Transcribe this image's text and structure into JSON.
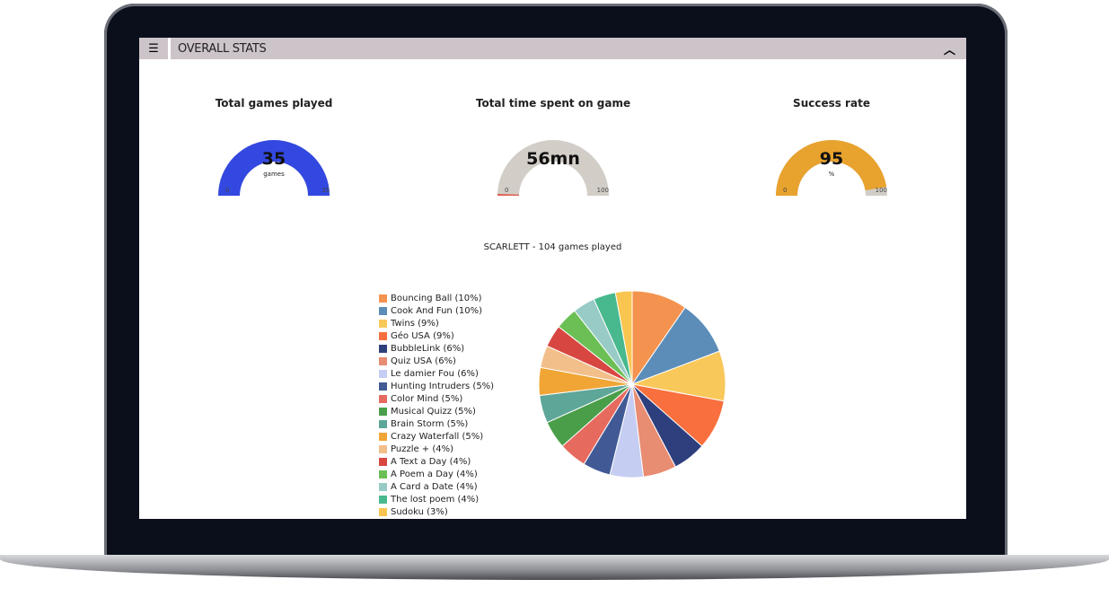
{
  "header": {
    "title": "OVERALL STATS",
    "menu_icon": "list-icon",
    "collapse_icon": "chevron-up-icon"
  },
  "gauges": [
    {
      "title": "Total games played",
      "value": "35",
      "unit": "games",
      "min": "0",
      "max": "35",
      "fill_fraction": 1.0,
      "color": "#3348e0"
    },
    {
      "title": "Total time spent on game",
      "value": "56mn",
      "unit": "",
      "min": "0",
      "max": "100",
      "fill_fraction": 0.01,
      "color": "#e05a4e"
    },
    {
      "title": "Success rate",
      "value": "95",
      "unit": "%",
      "min": "0",
      "max": "100",
      "fill_fraction": 0.95,
      "color": "#e8a22e"
    }
  ],
  "chart_data": {
    "type": "pie",
    "title": "SCARLETT - 104 games played",
    "legend_position": "left",
    "labels": [
      "Bouncing Ball (10%)",
      "Cook And Fun (10%)",
      "Twins (9%)",
      "Géo USA (9%)",
      "BubbleLink (6%)",
      "Quiz USA (6%)",
      "Le damier Fou (6%)",
      "Hunting Intruders (5%)",
      "Color Mind (5%)",
      "Musical Quizz (5%)",
      "Brain Storm (5%)",
      "Crazy Waterfall (5%)",
      "Puzzle + (4%)",
      "A Text a Day (4%)",
      "A Poem a Day (4%)",
      "A Card a Date (4%)",
      "The lost poem (4%)",
      "Sudoku (3%)"
    ],
    "values": [
      10,
      10,
      9,
      9,
      6,
      6,
      6,
      5,
      5,
      5,
      5,
      5,
      4,
      4,
      4,
      4,
      4,
      3
    ],
    "colors": [
      "#f4934f",
      "#5b8db8",
      "#f9c85a",
      "#f96f3d",
      "#2e3f7e",
      "#e88c72",
      "#c6cdf2",
      "#415a96",
      "#e66a5e",
      "#4a9e4a",
      "#5ea698",
      "#f0a535",
      "#f2bf8a",
      "#d84641",
      "#6cbf55",
      "#98cbc6",
      "#48b98e",
      "#f8c650"
    ]
  }
}
